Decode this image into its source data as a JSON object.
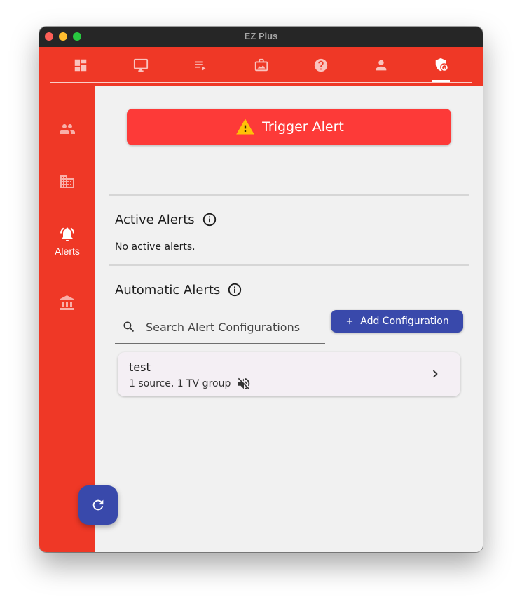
{
  "window": {
    "title": "EZ Plus"
  },
  "top_tabs": [
    {
      "icon": "dashboard-icon"
    },
    {
      "icon": "monitor-icon"
    },
    {
      "icon": "playlist-icon"
    },
    {
      "icon": "media-icon"
    },
    {
      "icon": "help-icon"
    },
    {
      "icon": "person-icon"
    },
    {
      "icon": "shield-admin-icon",
      "selected": true
    }
  ],
  "sidebar": {
    "items": [
      {
        "icon": "people-icon",
        "label": ""
      },
      {
        "icon": "building-icon",
        "label": ""
      },
      {
        "icon": "alarm-bell-icon",
        "label": "Alerts",
        "selected": true
      },
      {
        "icon": "bank-icon",
        "label": ""
      }
    ]
  },
  "main": {
    "trigger_button": "Trigger Alert",
    "active_alerts": {
      "title": "Active Alerts",
      "empty_text": "No active alerts."
    },
    "automatic_alerts": {
      "title": "Automatic Alerts",
      "search_placeholder": "Search Alert Configurations",
      "add_button": "Add Configuration",
      "configurations": [
        {
          "name": "test",
          "details": "1 source, 1 TV group",
          "muted": true
        }
      ]
    }
  },
  "colors": {
    "primary_red": "#ef3826",
    "trigger_red": "#fd3a38",
    "accent_blue": "#3949ab",
    "background": "#f1f1f1",
    "card": "#f4eff4",
    "warning_yellow": "#ffc107"
  }
}
